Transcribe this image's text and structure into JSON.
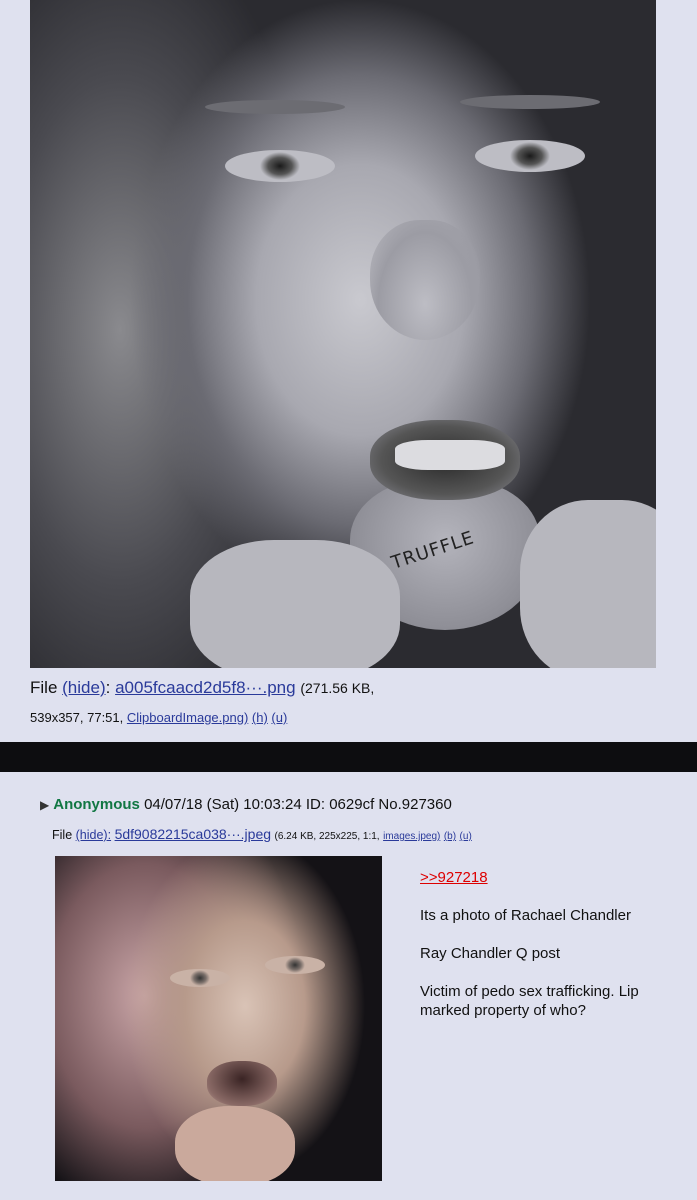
{
  "top_post": {
    "file_prefix": "File",
    "hide_label": "(hide)",
    "file_name": "a005fcaacd2d5f8···.png",
    "file_size": "(271.56 KB,",
    "file_details_line2": "539x357, 77:51,",
    "original_name": "ClipboardImage.png)",
    "h_link": "(h)",
    "u_link": "(u)",
    "lip_text": "TRUFFLE"
  },
  "bottom_post": {
    "name": "Anonymous",
    "date": "04/07/18 (Sat) 10:03:24",
    "id": "ID: 0629cf",
    "post_no": "No.927360",
    "file_prefix": "File",
    "hide_label": "(hide):",
    "file_name": "5df9082215ca038···.jpeg",
    "file_size": "(6.24 KB, 225x225, 1:1,",
    "original_name": "images.jpeg)",
    "b_link": "(b)",
    "u_link": "(u)",
    "quote": ">>927218",
    "lines": [
      "Its a photo of Rachael Chandler",
      "Ray Chandler Q post",
      "Victim of pedo sex trafficking. Lip marked property of who?"
    ]
  }
}
